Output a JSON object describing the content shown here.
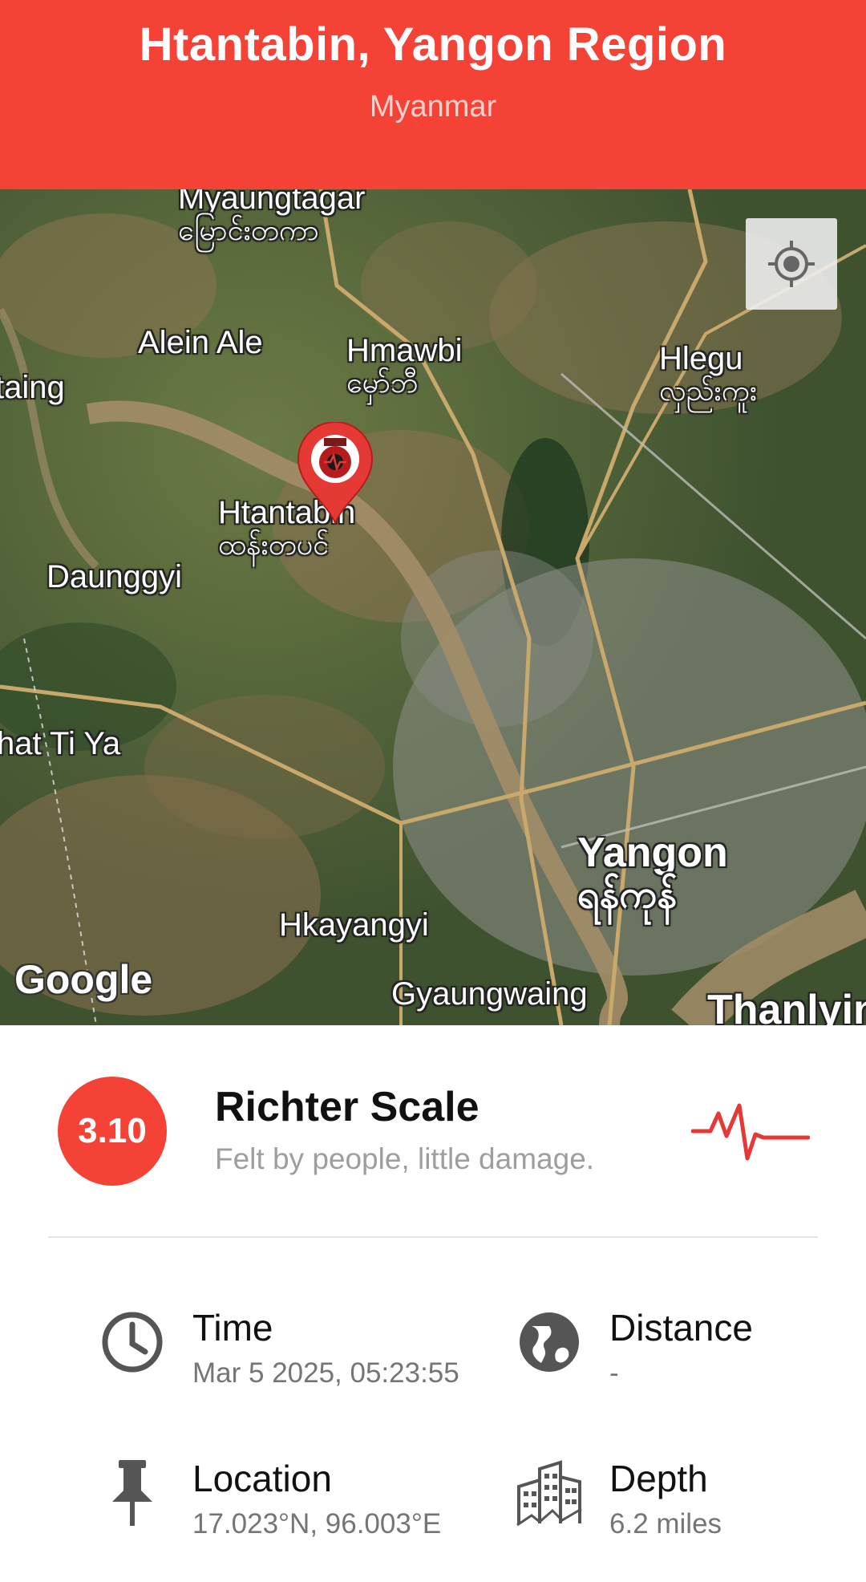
{
  "header": {
    "title": "Htantabin, Yangon Region",
    "subtitle": "Myanmar",
    "color": "#f44336"
  },
  "map": {
    "attribution": "Google",
    "locate_icon": "my-location-icon",
    "marker_icon": "map-pin-icon",
    "labels": {
      "myaungtagar": "Myaungtagar",
      "myaungtagar_mm": "မြောင်းတကာ",
      "alein_ale": "Alein Ale",
      "hmawbi": "Hmawbi",
      "hmawbi_mm": "မှော်ဘီ",
      "hlegu": "Hlegu",
      "hlegu_mm": "လှည်းကူး",
      "taing": "taing",
      "htantabin": "Htantabin",
      "htantabin_mm": "ထန်းတပင်",
      "daunggyi": "Daunggyi",
      "nat_ti_ya": "hat Ti Ya",
      "yangon": "Yangon",
      "yangon_mm": "ရန်ကုန်",
      "hkayangyi": "Hkayangyi",
      "gyaungwaing": "Gyaungwaing",
      "thanlyin": "Thanlyin"
    }
  },
  "quake": {
    "magnitude": "3.10",
    "scale_title": "Richter Scale",
    "scale_description": "Felt by people, little damage.",
    "scale_icon": "pulse-icon"
  },
  "details": {
    "time": {
      "label": "Time",
      "value": "Mar 5 2025, 05:23:55",
      "icon": "clock-icon"
    },
    "distance": {
      "label": "Distance",
      "value": "-",
      "icon": "globe-icon"
    },
    "location": {
      "label": "Location",
      "value": "17.023°N, 96.003°E",
      "icon": "pushpin-icon"
    },
    "depth": {
      "label": "Depth",
      "value": "6.2 miles",
      "icon": "buildings-icon"
    }
  }
}
